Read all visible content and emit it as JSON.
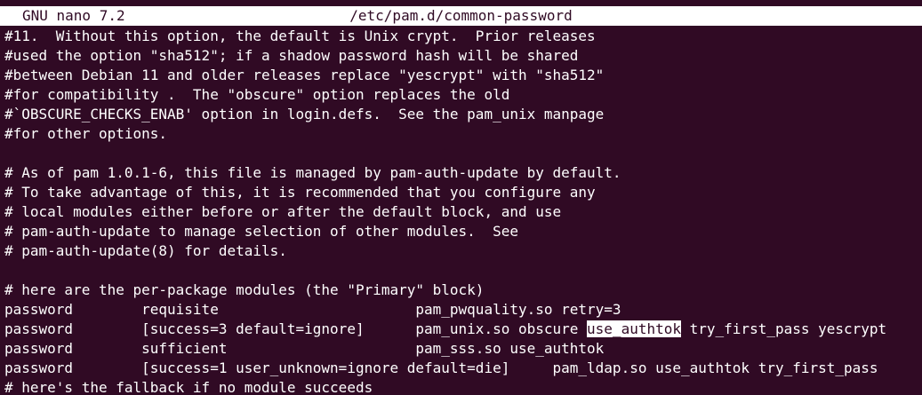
{
  "title_bar": {
    "app_name": "GNU nano 7.2",
    "file_path": "/etc/pam.d/common-password"
  },
  "editor": {
    "lines": [
      "#11.  Without this option, the default is Unix crypt.  Prior releases",
      "#used the option \"sha512\"; if a shadow password hash will be shared",
      "#between Debian 11 and older releases replace \"yescrypt\" with \"sha512\"",
      "#for compatibility .  The \"obscure\" option replaces the old",
      "#`OBSCURE_CHECKS_ENAB' option in login.defs.  See the pam_unix manpage",
      "#for other options.",
      "",
      "# As of pam 1.0.1-6, this file is managed by pam-auth-update by default.",
      "# To take advantage of this, it is recommended that you configure any",
      "# local modules either before or after the default block, and use",
      "# pam-auth-update to manage selection of other modules.  See",
      "# pam-auth-update(8) for details.",
      "",
      "# here are the per-package modules (the \"Primary\" block)",
      "password        requisite                       pam_pwquality.so retry=3",
      "password        [success=3 default=ignore]      pam_unix.so obscure ",
      "password        sufficient                      pam_sss.so use_authtok",
      "password        [success=1 user_unknown=ignore default=die]     pam_ldap.so use_authtok try_first_pass",
      "# here's the fallback if no module succeeds"
    ],
    "highlighted_text": "use_authtok",
    "after_highlight": " try_first_pass yescrypt"
  }
}
